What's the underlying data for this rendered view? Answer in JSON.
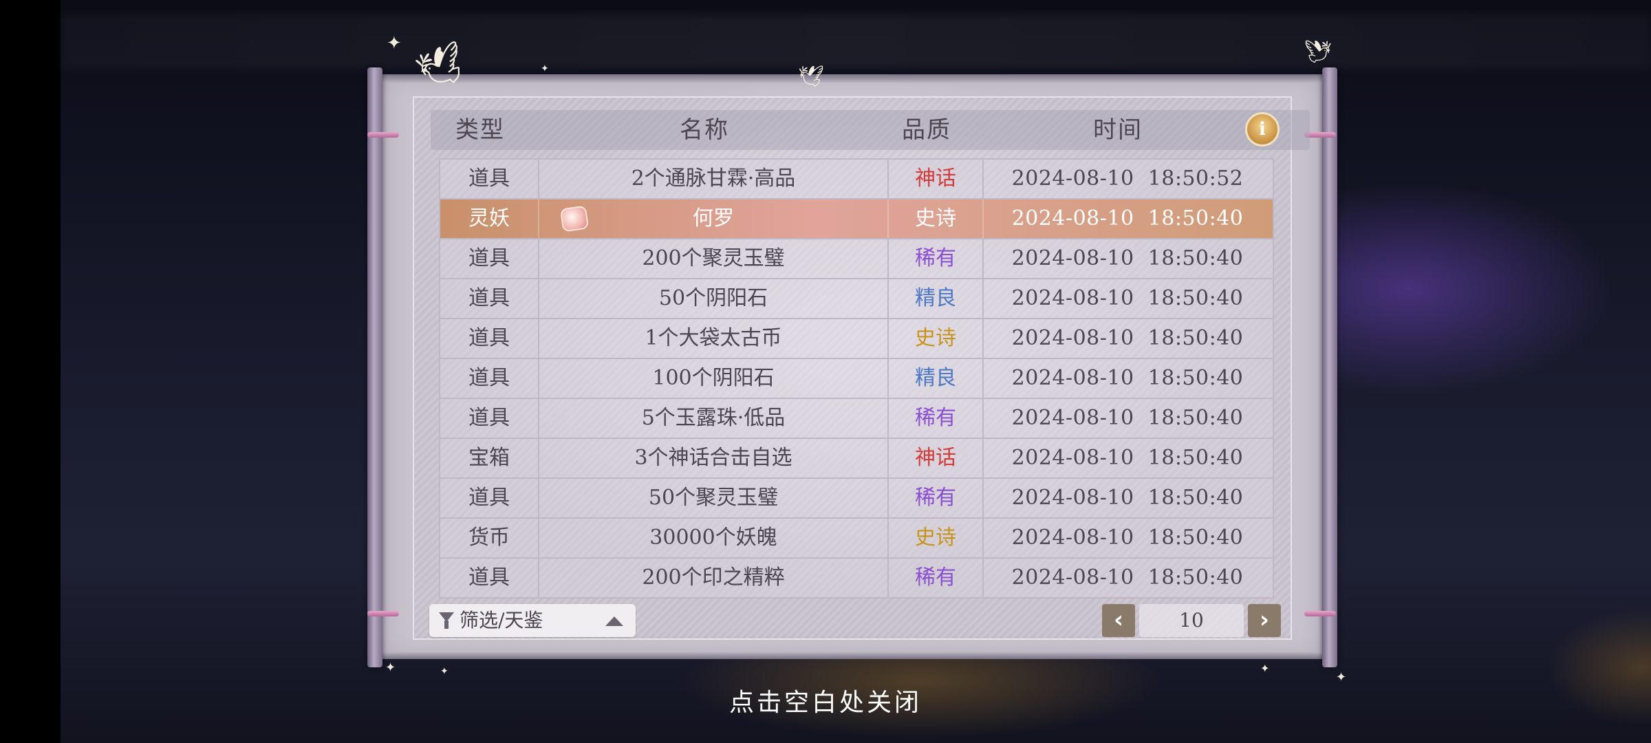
{
  "header": {
    "col_type": "类型",
    "col_name": "名称",
    "col_quality": "品质",
    "col_time": "时间",
    "info_icon": "info-icon"
  },
  "rows": [
    {
      "type": "道具",
      "name": "2个通脉甘霖·高品",
      "quality": "神话",
      "quality_class": "myth",
      "time": "2024-08-10  18:50:52"
    },
    {
      "type": "灵妖",
      "name": "何罗",
      "quality": "史诗",
      "quality_class": "epic",
      "time": "2024-08-10  18:50:40",
      "highlight": true
    },
    {
      "type": "道具",
      "name": "200个聚灵玉璧",
      "quality": "稀有",
      "quality_class": "rare",
      "time": "2024-08-10  18:50:40"
    },
    {
      "type": "道具",
      "name": "50个阴阳石",
      "quality": "精良",
      "quality_class": "good",
      "time": "2024-08-10  18:50:40"
    },
    {
      "type": "道具",
      "name": "1个大袋太古币",
      "quality": "史诗",
      "quality_class": "epic",
      "time": "2024-08-10  18:50:40"
    },
    {
      "type": "道具",
      "name": "100个阴阳石",
      "quality": "精良",
      "quality_class": "good",
      "time": "2024-08-10  18:50:40"
    },
    {
      "type": "道具",
      "name": "5个玉露珠·低品",
      "quality": "稀有",
      "quality_class": "rare",
      "time": "2024-08-10  18:50:40"
    },
    {
      "type": "宝箱",
      "name": "3个神话合击自选",
      "quality": "神话",
      "quality_class": "myth",
      "time": "2024-08-10  18:50:40"
    },
    {
      "type": "道具",
      "name": "50个聚灵玉璧",
      "quality": "稀有",
      "quality_class": "rare",
      "time": "2024-08-10  18:50:40"
    },
    {
      "type": "货币",
      "name": "30000个妖魄",
      "quality": "史诗",
      "quality_class": "epic",
      "time": "2024-08-10  18:50:40"
    },
    {
      "type": "道具",
      "name": "200个印之精粹",
      "quality": "稀有",
      "quality_class": "rare",
      "time": "2024-08-10  18:50:40"
    }
  ],
  "filter": {
    "label": "筛选/天鉴"
  },
  "pagination": {
    "page": "10",
    "prev_symbol": "‹",
    "next_symbol": "›"
  },
  "close_hint": "点击空白处关闭",
  "colors": {
    "myth": "#d33a3a",
    "epic": "#c8931a",
    "rare": "#8a4fd0",
    "good": "#4a78c4",
    "highlight_row": "#d09c78"
  }
}
